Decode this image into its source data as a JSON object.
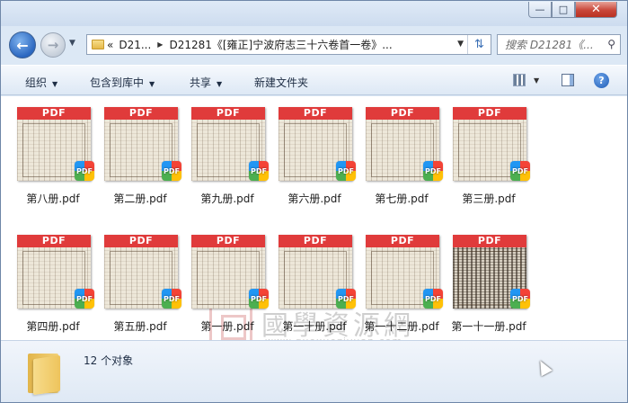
{
  "window": {
    "controls": {
      "minimize": "—",
      "maximize": "□",
      "close": "✕"
    }
  },
  "navigation": {
    "back_icon": "back-arrow-icon",
    "forward_icon": "forward-arrow-icon",
    "history_icon": "chevron-down-icon"
  },
  "address": {
    "overflow": "«",
    "crumbs": [
      "D21...",
      "D21281《[雍正]宁波府志三十六卷首一卷》..."
    ],
    "refresh_icon": "refresh-icon"
  },
  "search": {
    "placeholder": "搜索 D21281《..."
  },
  "toolbar": {
    "organize": "组织",
    "include_library": "包含到库中",
    "share": "共享",
    "new_folder": "新建文件夹"
  },
  "files": [
    {
      "name": "第八册.pdf",
      "banner": "PDF",
      "scan_style": "light"
    },
    {
      "name": "第二册.pdf",
      "banner": "PDF",
      "scan_style": "light"
    },
    {
      "name": "第九册.pdf",
      "banner": "PDF",
      "scan_style": "light"
    },
    {
      "name": "第六册.pdf",
      "banner": "PDF",
      "scan_style": "light"
    },
    {
      "name": "第七册.pdf",
      "banner": "PDF",
      "scan_style": "light"
    },
    {
      "name": "第三册.pdf",
      "banner": "PDF",
      "scan_style": "light"
    },
    {
      "name": "第四册.pdf",
      "banner": "PDF",
      "scan_style": "light"
    },
    {
      "name": "第五册.pdf",
      "banner": "PDF",
      "scan_style": "light"
    },
    {
      "name": "第一册.pdf",
      "banner": "PDF",
      "scan_style": "light"
    },
    {
      "name": "第一十册.pdf",
      "banner": "PDF",
      "scan_style": "light"
    },
    {
      "name": "第一十二册.pdf",
      "banner": "PDF",
      "scan_style": "light"
    },
    {
      "name": "第一十一册.pdf",
      "banner": "PDF",
      "scan_style": "dark"
    }
  ],
  "badge_label": "PDF",
  "watermark": {
    "title": "國學資源網",
    "url": "www.guoxueziyuan.com"
  },
  "details": {
    "count": "12 个对象"
  },
  "colors": {
    "pdf_banner": "#e03b3b",
    "accent": "#2b67c0"
  }
}
